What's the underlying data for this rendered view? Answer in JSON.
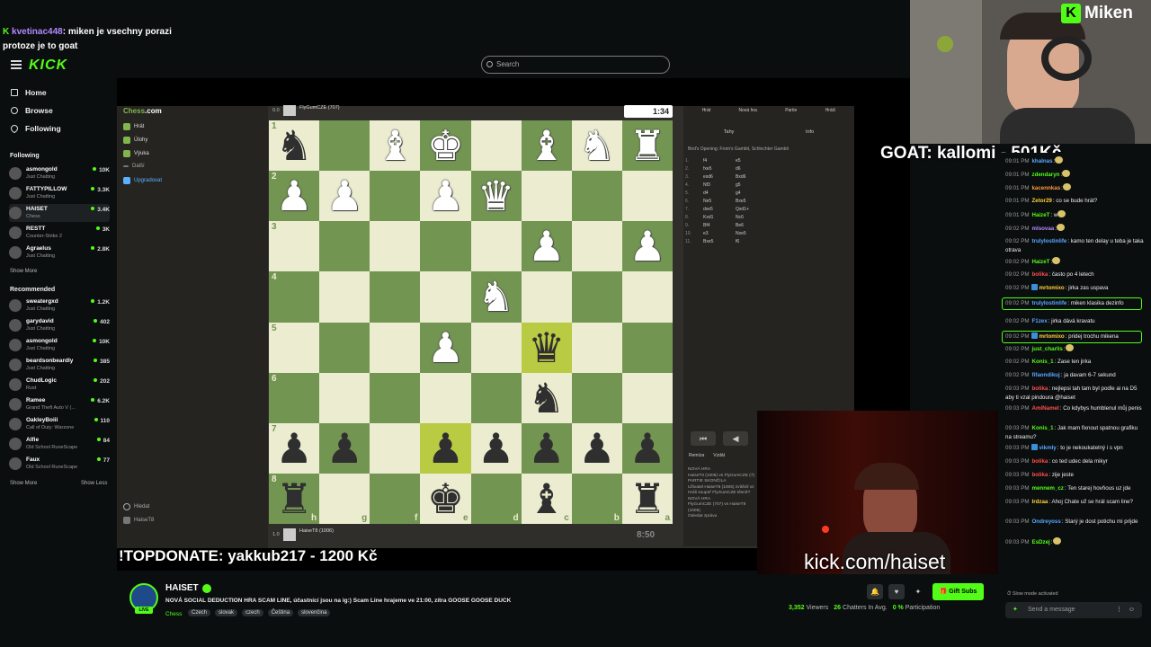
{
  "overlay_chat": {
    "user": "kvetinac448",
    "text": ": miken je vsechny porazi",
    "text2": "protoze je to goat"
  },
  "header": {
    "logo": "KICK",
    "search_placeholder": "Search"
  },
  "nav": [
    {
      "label": "Home",
      "icon": "home-icon"
    },
    {
      "label": "Browse",
      "icon": "compass-icon"
    },
    {
      "label": "Following",
      "icon": "heart-icon"
    }
  ],
  "following": {
    "title": "Following",
    "channels": [
      {
        "name": "asmongold",
        "game": "Just Chatting",
        "viewers": "10K"
      },
      {
        "name": "FATTYPILLOW",
        "game": "Just Chatting",
        "viewers": "3.3K"
      },
      {
        "name": "HAISET",
        "game": "Chess",
        "viewers": "3.4K"
      },
      {
        "name": "RESTT",
        "game": "Counter-Strike 2",
        "viewers": "3K"
      },
      {
        "name": "Agraelus",
        "game": "Just Chatting",
        "viewers": "2.8K"
      }
    ],
    "show_more": "Show More"
  },
  "recommended": {
    "title": "Recommended",
    "channels": [
      {
        "name": "sweatergxd",
        "game": "Just Chatting",
        "viewers": "1.2K"
      },
      {
        "name": "garydavid",
        "game": "Just Chatting",
        "viewers": "402"
      },
      {
        "name": "asmongold",
        "game": "Just Chatting",
        "viewers": "10K"
      },
      {
        "name": "beardsonbeardly",
        "game": "Just Chatting",
        "viewers": "385"
      },
      {
        "name": "ChudLogic",
        "game": "Rust",
        "viewers": "202"
      },
      {
        "name": "Ramee",
        "game": "Grand Theft Auto V (...",
        "viewers": "6.2K"
      },
      {
        "name": "OakleyBoiii",
        "game": "Call of Duty: Warzone",
        "viewers": "110"
      },
      {
        "name": "Alfie",
        "game": "Old School RuneScape",
        "viewers": "84"
      },
      {
        "name": "Faux",
        "game": "Old School RuneScape",
        "viewers": "77"
      }
    ],
    "show_more": "Show More",
    "show_less": "Show Less"
  },
  "chesscom": {
    "logo_a": "Chess",
    "logo_b": ".com",
    "nav": [
      "Hrát",
      "Úlohy",
      "Výuka",
      "Další"
    ],
    "upgrade": "Upgradovat",
    "footer": [
      "Hledat",
      "HaiseT8"
    ]
  },
  "board": {
    "ranks": [
      "1",
      "2",
      "3",
      "4",
      "5",
      "6",
      "7",
      "8"
    ],
    "files": [
      "h",
      "g",
      "f",
      "e",
      "d",
      "c",
      "b",
      "a"
    ],
    "rows": [
      [
        "bn",
        "",
        "wb",
        "wk",
        "",
        "wb",
        "wn",
        "wr"
      ],
      [
        "wp",
        "wp",
        "",
        "wp",
        "wq",
        "",
        "",
        ""
      ],
      [
        "",
        "",
        "",
        "",
        "",
        "wp",
        "",
        "wp"
      ],
      [
        "",
        "",
        "",
        "",
        "wn",
        "",
        "",
        ""
      ],
      [
        "",
        "",
        "",
        "wp",
        "",
        "bq",
        "",
        ""
      ],
      [
        "",
        "",
        "",
        "",
        "",
        "bn",
        "",
        ""
      ],
      [
        "bp",
        "bp",
        "",
        "bp",
        "bp",
        "bp",
        "bp",
        "bp"
      ],
      [
        "br",
        "",
        "",
        "bk",
        "",
        "bb",
        "",
        "br"
      ]
    ],
    "highlights": [
      "4-5",
      "6-3"
    ],
    "top_player": "FlyGumCZE (707)",
    "top_score": "0.0",
    "top_clock": "1:34",
    "bottom_player": "HaiseT8 (1006)",
    "bottom_score": "1.0",
    "bottom_clock": "8:50"
  },
  "chess_panel": {
    "tabs": [
      "Hrát",
      "Nová hra",
      "Partie",
      "Hráči"
    ],
    "subtabs": [
      "Tahy",
      "Info"
    ],
    "opening": "Bird's Opening: From's Gambit, Schlechter Gambit",
    "moves": [
      [
        "1.",
        "f4",
        "e5"
      ],
      [
        "2.",
        "fxe5",
        "d6"
      ],
      [
        "3.",
        "exd6",
        "Bxd6"
      ],
      [
        "4.",
        "Nf3",
        "g5"
      ],
      [
        "5.",
        "d4",
        "g4"
      ],
      [
        "6.",
        "Ne5",
        "Bxe5"
      ],
      [
        "7.",
        "dxe5",
        "Qxd1+"
      ],
      [
        "8.",
        "Kxd1",
        "Nc6"
      ],
      [
        "9.",
        "Bf4",
        "Be6"
      ],
      [
        "10.",
        "e3",
        "Nxe5"
      ],
      [
        "11.",
        "Bxe5",
        "f6"
      ]
    ],
    "controls": [
      "⏮",
      "◀"
    ],
    "actions": [
      "Remíza",
      "Vzdát"
    ],
    "log": [
      "NOVÁ HRA",
      "HaiseT8 (1006) vs FlyGumCZE (7)",
      "PARTIE SKONČILA",
      "Uživatel HaiseT8 (1006) zvítězil vz",
      "Hráli soupeř FlyGumCZE těsně?",
      "NOVÁ HRA",
      "FlyGumCZE (707) vs HaiseT8 (1006)",
      "Odeslat zprávu"
    ]
  },
  "overlays": {
    "brand": "Miken",
    "goat": "GOAT: kallomi - 501Kč",
    "topdonate": "!TOPDONATE: yakkub217 - 1200 Kč",
    "kick_url": "kick.com/haiset"
  },
  "chat": {
    "messages": [
      {
        "time": "09:01 PM",
        "user": "khalnas",
        "color": "#5aa7ff",
        "text": ":",
        "emote": true
      },
      {
        "time": "09:01 PM",
        "user": "zdendaryn",
        "color": "#53fc18",
        "text": ":",
        "emote": true
      },
      {
        "time": "09:01 PM",
        "user": "kacennkas",
        "color": "#ff9a3c",
        "text": ":",
        "emote": true
      },
      {
        "time": "09:01 PM",
        "user": "Zetor29",
        "color": "#ffd23c",
        "text": ": co se bude hrát?"
      },
      {
        "time": "09:01 PM",
        "user": "HaizeT",
        "color": "#53fc18",
        "text": ":  w",
        "emote": true
      },
      {
        "time": "09:02 PM",
        "user": "mlsovaa",
        "color": "#b389ff",
        "text": ":",
        "emote": true
      },
      {
        "time": "09:02 PM",
        "user": "trulyIostinlife",
        "color": "#5aa7ff",
        "text": ": kamo ten delay u teba je taka otrava"
      },
      {
        "time": "09:02 PM",
        "user": "HaizeT",
        "color": "#53fc18",
        "text": ":",
        "emote": true
      },
      {
        "time": "09:02 PM",
        "user": "bolika",
        "color": "#ff4d4d",
        "text": ": často po 4 letech"
      },
      {
        "time": "09:02 PM",
        "user": "mrtomixo",
        "color": "#ffd23c",
        "text": ": jirka zas uspava",
        "badge": true
      },
      {
        "time": "09:02 PM",
        "user": "trulyIostinlife",
        "color": "#5aa7ff",
        "text": ": miken klasika dezinfo",
        "box": true
      },
      {
        "time": "09:02 PM",
        "user": "F1zex",
        "color": "#5aa7ff",
        "text": ": jirka dává kravatu"
      },
      {
        "time": "09:02 PM",
        "user": "mrtomixo",
        "color": "#ffd23c",
        "text": ": pridej trochu mikena",
        "badge": true,
        "box": true
      },
      {
        "time": "09:02 PM",
        "user": "just_charlis",
        "color": "#53fc18",
        "text": ":",
        "emote": true
      },
      {
        "time": "09:02 PM",
        "user": "Konis_1",
        "color": "#53fc18",
        "text": ": Zase ten jirka"
      },
      {
        "time": "09:02 PM",
        "user": "fifaondikuj",
        "color": "#5aa7ff",
        "text": ": ja davam 6-7 sekund"
      },
      {
        "time": "09:03 PM",
        "user": "bolika",
        "color": "#ff4d4d",
        "text": ": nejlepsi tah tam byl podle ai na D5 aby ti vzal pindoura @haiset"
      },
      {
        "time": "09:03 PM",
        "user": "AmiNamel",
        "color": "#ff4d4d",
        "text": ": Co kdybys humblenul můj penis"
      },
      {
        "time": "09:03 PM",
        "user": "Konis_1",
        "color": "#53fc18",
        "text": ": Jak mam fixnout spatnou grafiku na streamu?"
      },
      {
        "time": "09:03 PM",
        "user": "vikmly",
        "color": "#5aa7ff",
        "text": ": to je nekoukatelný i s vpn",
        "badge": true
      },
      {
        "time": "09:03 PM",
        "user": "bolika",
        "color": "#ff4d4d",
        "text": ": co ted udec dela mikyr"
      },
      {
        "time": "09:03 PM",
        "user": "bolika",
        "color": "#ff4d4d",
        "text": ": zije jeste"
      },
      {
        "time": "09:03 PM",
        "user": "mennem_cz",
        "color": "#53fc18",
        "text": ": Ten starej hovňous uz jde"
      },
      {
        "time": "09:03 PM",
        "user": "Irdzaa",
        "color": "#ffd23c",
        "text": ": Ahoj Chate už se hrál scam line?"
      },
      {
        "time": "09:03 PM",
        "user": "Ondreyoss",
        "color": "#5aa7ff",
        "text": ": Starý je dost potichu mi prijde"
      },
      {
        "time": "09:03 PM",
        "user": "EsDzej",
        "color": "#53fc18",
        "text": ":",
        "emote": true
      }
    ],
    "slow_mode": "Slow mode activated",
    "input_placeholder": "Send a message"
  },
  "stream": {
    "name": "HAISET",
    "title": "NOVÁ SOCIAL DEDUCTION HRA SCAM LINE, účastnící jsou na ig:) Scam Line hrajeme ve 21:00, zítra GOOSE GOOSE DUCK",
    "category": "Chess",
    "tags": [
      "Czech",
      "slovak",
      "czech",
      "Čeština",
      "slovenčina"
    ],
    "live": "LIVE",
    "gift_subs": "Gift Subs",
    "viewers": "3,352",
    "viewers_label": "Viewers",
    "chatters": "26",
    "chatters_label": "Chatters In Avg.",
    "participation": "0 %",
    "participation_label": "Participation"
  }
}
